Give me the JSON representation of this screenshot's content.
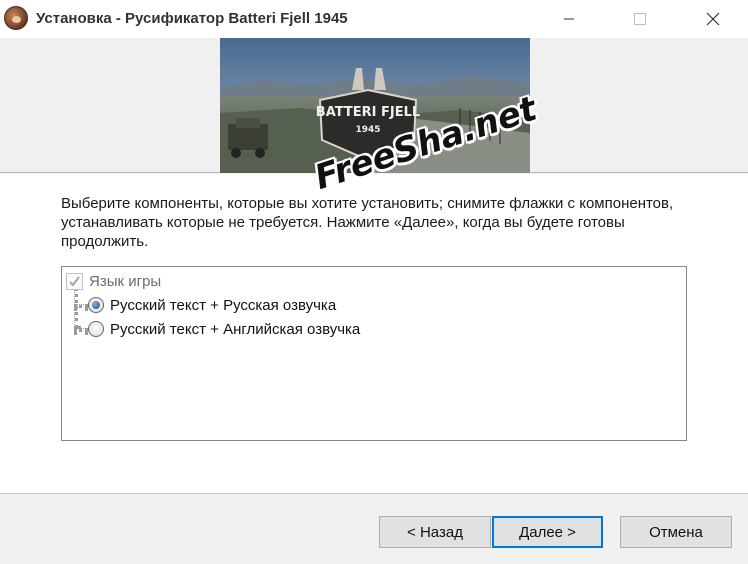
{
  "window": {
    "title": "Установка - Русификатор Batteri Fjell 1945"
  },
  "banner": {
    "logo_line1": "BATTERI FJELL",
    "logo_line2": "1945"
  },
  "main": {
    "description": "Выберите компоненты, которые вы хотите установить; снимите флажки с компонентов, устанавливать которые не требуется. Нажмите «Далее», когда вы будете готовы продолжить."
  },
  "components": {
    "root": {
      "label": "Язык игры",
      "checked": true,
      "disabled": true
    },
    "options": [
      {
        "label": "Русский текст + Русская озвучка",
        "selected": true
      },
      {
        "label": "Русский текст + Английская озвучка",
        "selected": false
      }
    ]
  },
  "buttons": {
    "back": "< Назад",
    "next": "Далее >",
    "cancel": "Отмена"
  },
  "watermark": "FreeSha.net"
}
